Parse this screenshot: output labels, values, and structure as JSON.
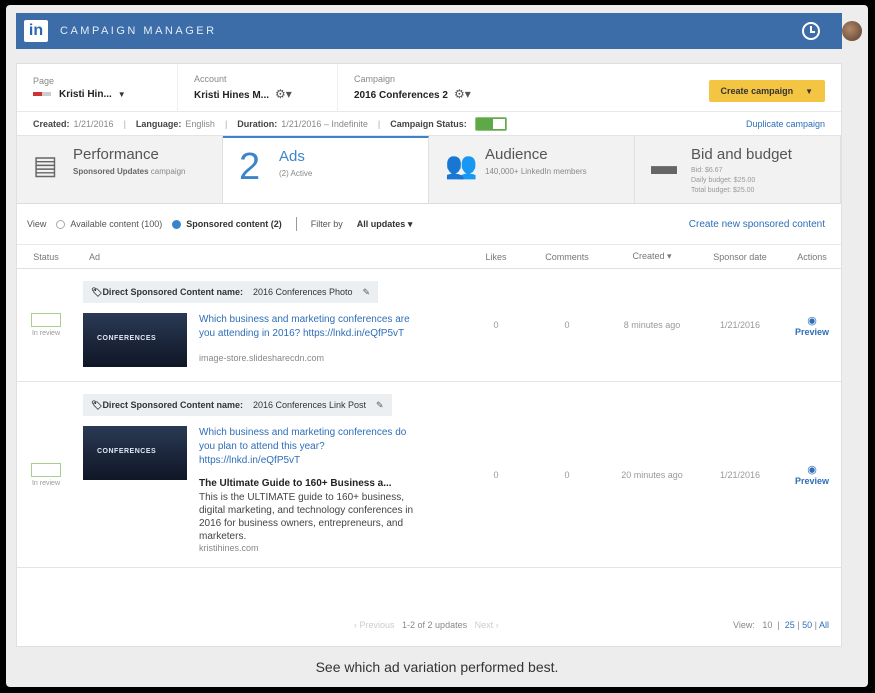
{
  "app": {
    "logo": "in",
    "title": "CAMPAIGN MANAGER"
  },
  "selectors": {
    "page": {
      "label": "Page",
      "value": "Kristi Hin..."
    },
    "account": {
      "label": "Account",
      "value": "Kristi Hines M..."
    },
    "campaign": {
      "label": "Campaign",
      "value": "2016 Conferences 2"
    }
  },
  "create_campaign_label": "Create campaign",
  "info": {
    "created_label": "Created:",
    "created_value": "1/21/2016",
    "language_label": "Language:",
    "language_value": "English",
    "duration_label": "Duration:",
    "duration_value": "1/21/2016 – Indefinite",
    "status_label": "Campaign Status:",
    "status_on": true,
    "duplicate": "Duplicate campaign"
  },
  "tabs": [
    {
      "title": "Performance",
      "sub_bold": "Sponsored Updates",
      "sub": " campaign"
    },
    {
      "number": "2",
      "title": "Ads",
      "sub": "(2) Active"
    },
    {
      "title": "Audience",
      "sub": "140,000+ LinkedIn members"
    },
    {
      "title": "Bid and budget",
      "lines": [
        "Bid: $6.67",
        "Daily budget: $25.00",
        "Total budget: $25.00"
      ]
    }
  ],
  "filter": {
    "view_label": "View",
    "available": "Available content (100)",
    "sponsored": "Sponsored content (2)",
    "filter_by": "Filter by",
    "all_updates": "All updates",
    "create_link": "Create new sponsored content"
  },
  "columns": [
    "Status",
    "Ad",
    "Likes",
    "Comments",
    "Created",
    "Sponsor date",
    "Actions"
  ],
  "rows": [
    {
      "status": "In review",
      "name_label": "Direct Sponsored Content name:",
      "name": "2016 Conferences Photo",
      "link": "Which business and marketing conferences are you attending in 2016? https://lnkd.in/eQfP5vT",
      "domain": "image-store.slidesharecdn.com",
      "likes": "0",
      "comments": "0",
      "created": "8 minutes ago",
      "sponsor_date": "1/21/2016",
      "action": "Preview"
    },
    {
      "status": "In review",
      "name_label": "Direct Sponsored Content name:",
      "name": "2016 Conferences Link Post",
      "link": "Which business and marketing conferences do you plan to attend this year? https://lnkd.in/eQfP5vT",
      "headline": "The Ultimate Guide to 160+ Business a...",
      "desc": "This is the ULTIMATE guide to 160+ business, digital marketing, and technology conferences in 2016 for business owners, entrepreneurs, and marketers.",
      "domain": "kristihines.com",
      "likes": "0",
      "comments": "0",
      "created": "20 minutes ago",
      "sponsor_date": "1/21/2016",
      "action": "Preview"
    }
  ],
  "thumb_text": "CONFERENCES",
  "pager": {
    "previous": "‹ Previous",
    "summary": "1-2 of 2 updates",
    "next": "Next ›",
    "view_label": "View:",
    "sizes": [
      "10",
      "25",
      "50",
      "All"
    ]
  },
  "caption": "See which ad variation performed best."
}
